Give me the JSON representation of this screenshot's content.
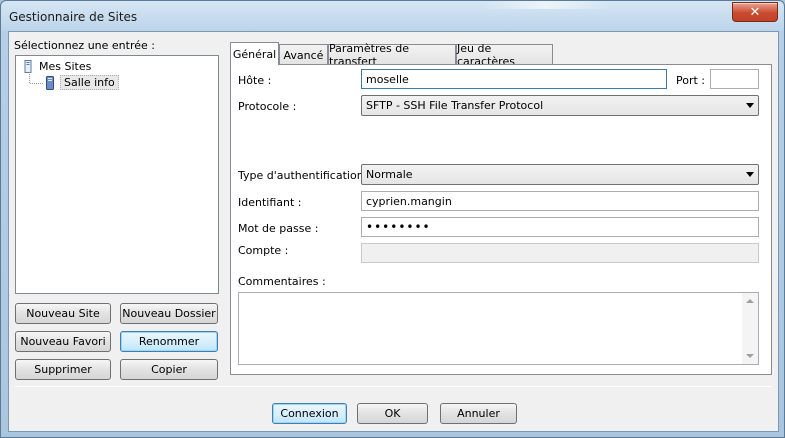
{
  "window": {
    "title": "Gestionnaire de Sites",
    "close_symbol": "✕"
  },
  "sidebar": {
    "select_label": "Sélectionnez une entrée :",
    "tree": {
      "root": "Mes Sites",
      "children": [
        "Salle info"
      ]
    },
    "buttons": {
      "new_site": "Nouveau Site",
      "new_folder": "Nouveau Dossier",
      "new_favorite": "Nouveau Favori",
      "rename": "Renommer",
      "delete": "Supprimer",
      "copy": "Copier"
    }
  },
  "tabs": [
    "Général",
    "Avancé",
    "Paramètres de transfert",
    "Jeu de caractères"
  ],
  "general": {
    "host_label": "Hôte :",
    "host_value": "moselle",
    "port_label": "Port :",
    "port_value": "",
    "protocol_label": "Protocole :",
    "protocol_value": "SFTP - SSH File Transfer Protocol",
    "auth_type_label": "Type d'authentification :",
    "auth_type_value": "Normale",
    "user_label": "Identifiant :",
    "user_value": "cyprien.mangin",
    "password_label": "Mot de passe :",
    "password_value": "••••••••",
    "account_label": "Compte :",
    "account_value": "",
    "comments_label": "Commentaires :",
    "comments_value": ""
  },
  "footer": {
    "connect": "Connexion",
    "ok": "OK",
    "cancel": "Annuler"
  }
}
